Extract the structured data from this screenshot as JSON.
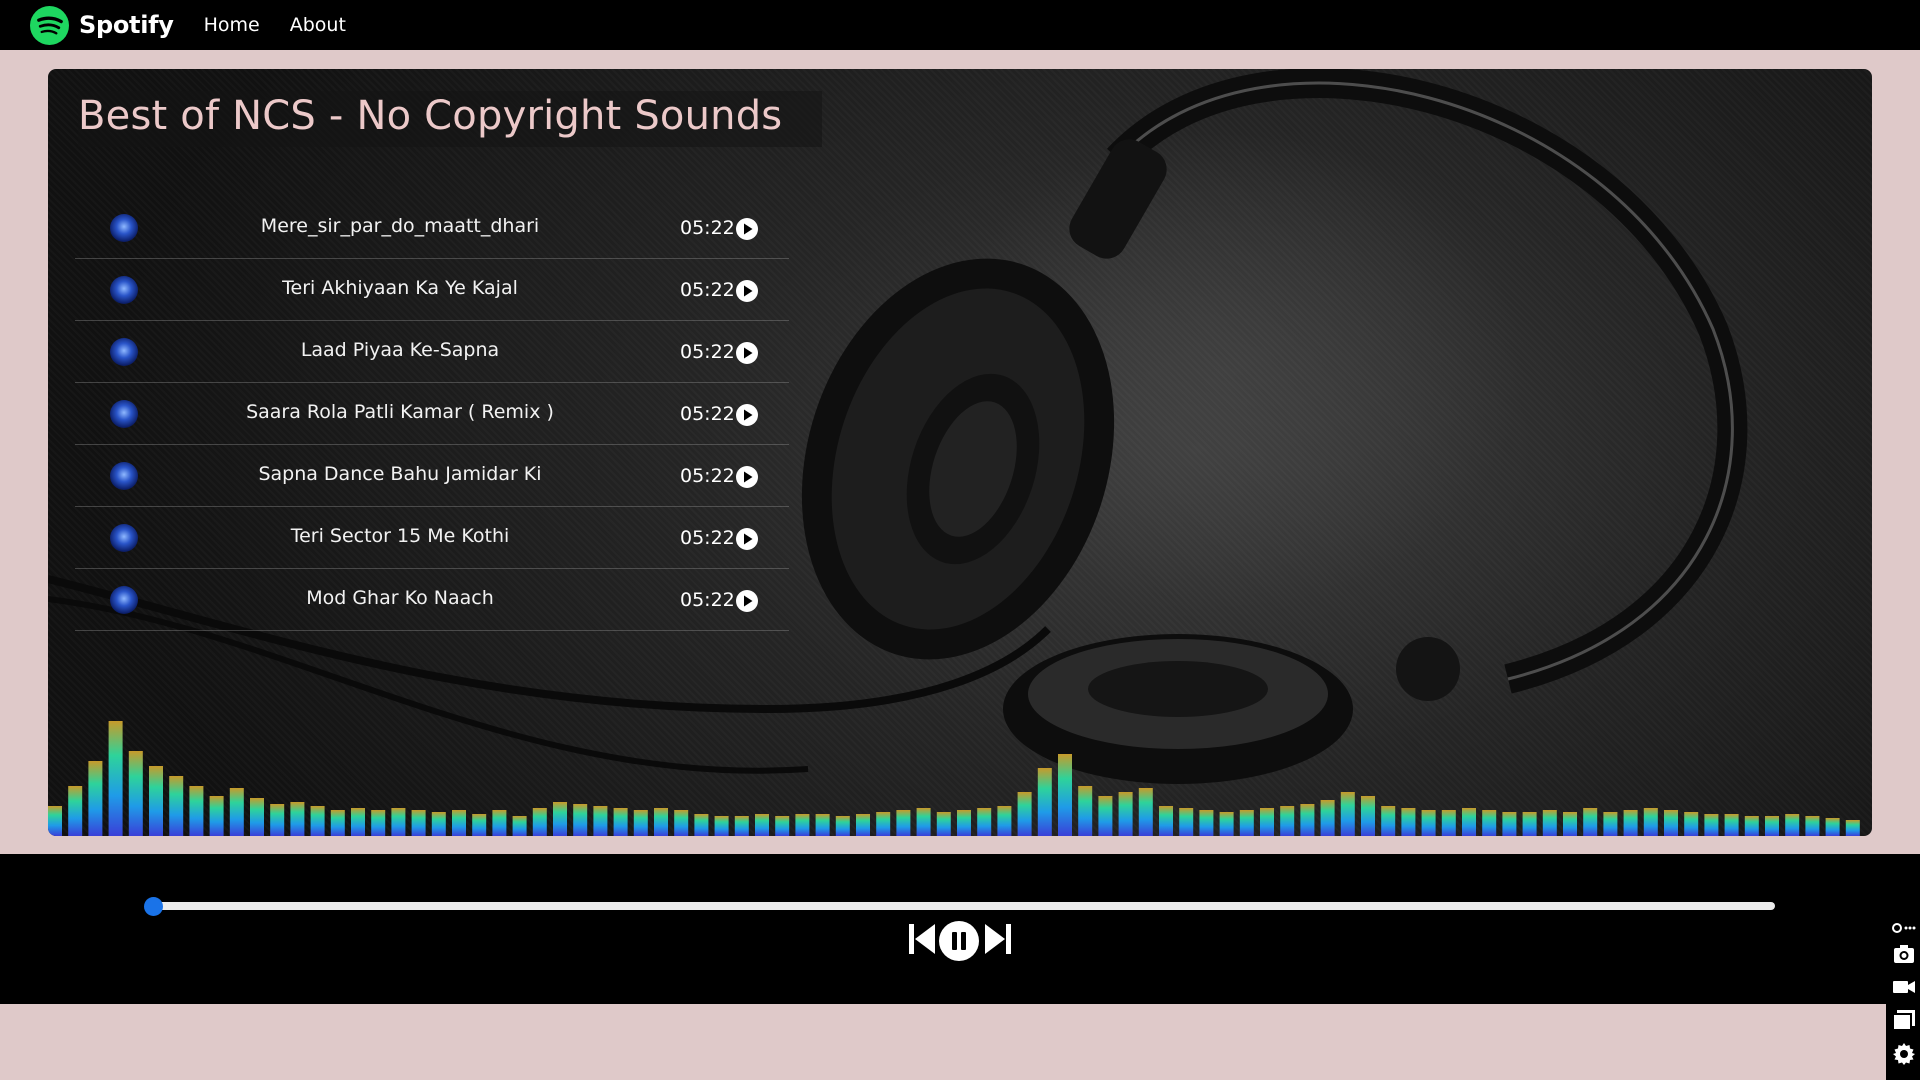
{
  "navbar": {
    "brand": "Spotify",
    "links": [
      "Home",
      "About"
    ]
  },
  "playlist": {
    "title": "Best of NCS - No Copyright Sounds",
    "songs": [
      {
        "name": "Mere_sir_par_do_maatt_dhari",
        "duration": "05:22"
      },
      {
        "name": "Teri Akhiyaan Ka Ye Kajal",
        "duration": "05:22"
      },
      {
        "name": "Laad Piyaa Ke-Sapna",
        "duration": "05:22"
      },
      {
        "name": "Saara Rola Patli Kamar ( Remix )",
        "duration": "05:22"
      },
      {
        "name": "Sapna Dance Bahu Jamidar Ki",
        "duration": "05:22"
      },
      {
        "name": "Teri Sector 15 Me Kothi",
        "duration": "05:22"
      },
      {
        "name": "Mod Ghar Ko Naach",
        "duration": "05:22"
      }
    ]
  },
  "player": {
    "progress": 0.0
  },
  "icons": {
    "brand_logo": "spotify-logo-icon",
    "song_thumb": "song-thumbnail-icon",
    "song_play": "play-circle-icon",
    "previous": "skip-previous-icon",
    "play_pause": "pause-circle-icon",
    "next": "skip-next-icon",
    "tools": [
      "extension-icon",
      "camera-icon",
      "video-camera-icon",
      "window-icon",
      "gear-icon"
    ]
  },
  "colors": {
    "page_background": "#dfc9c9",
    "bar_background": "#000000",
    "brand_green": "#1ed760",
    "title_pink": "#ecc9c9",
    "accent_blue": "#1a73e8"
  }
}
